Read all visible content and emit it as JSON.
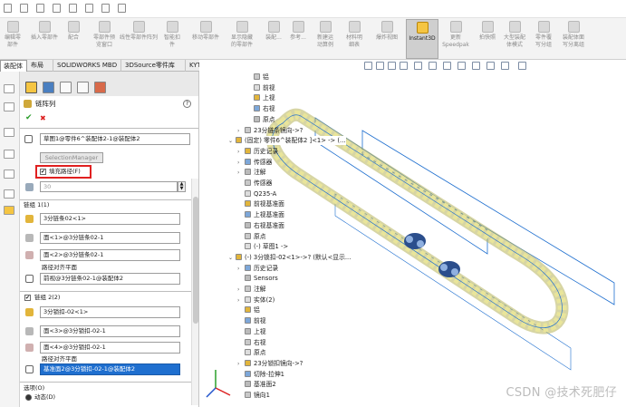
{
  "ribbon": {
    "commands": [
      {
        "label": "编辑零\n部件"
      },
      {
        "label": "插入零部件"
      },
      {
        "label": "配合"
      },
      {
        "label": "零部件预\n览窗口"
      },
      {
        "label": "线性零部件阵列"
      },
      {
        "label": "智能扣\n件"
      },
      {
        "label": "移动零部件"
      },
      {
        "label": "显示隐藏\n的零部件"
      },
      {
        "label": "装配..."
      },
      {
        "label": "参考..."
      },
      {
        "label": "新建运\n动算例"
      },
      {
        "label": "材料明\n细表"
      },
      {
        "label": "爆炸视图"
      },
      {
        "label": "Instant3D"
      },
      {
        "label": "更新\nSpeedpak"
      },
      {
        "label": "拍快照"
      },
      {
        "label": "大型装配\n体模式"
      },
      {
        "label": "零件覆\n写分组"
      },
      {
        "label": "装配体面\n写分离组"
      }
    ]
  },
  "tabs": [
    "装配体",
    "布局",
    "SOLIDWORKS MBD",
    "3DSource零件库",
    "KYTool"
  ],
  "panel": {
    "title": "链阵列",
    "help": "?",
    "ok": "✔",
    "cancel": "✖",
    "path_field": "草图1@零件6^装配体2-1@装配体2",
    "selection_manager": "SelectionManager",
    "fill_path": "填充路径(F)",
    "fill_checked": "✔",
    "count_value": "30",
    "group1": {
      "title": "链组 1(1)",
      "f1": "3分链条02<1>",
      "f2": "面<1>@3分链条02-1",
      "f3": "面<2>@3分链条02-1",
      "path_plane_label": "路径对齐平面",
      "path_plane": "前视@3分链条02-1@装配体2"
    },
    "group2": {
      "title": "链组 2(2)",
      "checked": "✔",
      "f1": "3分锁扣-02<1>",
      "f2": "面<3>@3分锁扣-02-1",
      "f3": "面<4>@3分锁扣-02-1",
      "path_plane_label": "路径对齐平面",
      "path_plane": "基准面2@3分锁扣-02-1@装配体2"
    },
    "options": {
      "title": "选项(O)",
      "dynamic": "动态(D)"
    }
  },
  "tree": [
    {
      "text": "铝",
      "indent": 2,
      "arrow": ""
    },
    {
      "text": "前视",
      "indent": 2,
      "arrow": ""
    },
    {
      "text": "上视",
      "indent": 2,
      "arrow": ""
    },
    {
      "text": "右视",
      "indent": 2,
      "arrow": ""
    },
    {
      "text": "原点",
      "indent": 2,
      "arrow": ""
    },
    {
      "text": "23分链条镜向->?",
      "indent": 1,
      "arrow": "›"
    },
    {
      "text": "(固定) 零件6^装配体2 ]<1> -> (...",
      "indent": 0,
      "arrow": "⌄"
    },
    {
      "text": "历史记录",
      "indent": 1,
      "arrow": "›"
    },
    {
      "text": "传感器",
      "indent": 1,
      "arrow": "›"
    },
    {
      "text": "注解",
      "indent": 1,
      "arrow": "›"
    },
    {
      "text": "传感器",
      "indent": 1,
      "arrow": ""
    },
    {
      "text": "Q235-A",
      "indent": 1,
      "arrow": ""
    },
    {
      "text": "前视基准面",
      "indent": 1,
      "arrow": ""
    },
    {
      "text": "上视基准面",
      "indent": 1,
      "arrow": ""
    },
    {
      "text": "右视基准面",
      "indent": 1,
      "arrow": ""
    },
    {
      "text": "原点",
      "indent": 1,
      "arrow": ""
    },
    {
      "text": "(-) 草图1 ->",
      "indent": 1,
      "arrow": ""
    },
    {
      "text": "(-) 3分锁扣-02<1>->? (默认<显示...",
      "indent": 0,
      "arrow": "⌄"
    },
    {
      "text": "历史记录",
      "indent": 1,
      "arrow": "›"
    },
    {
      "text": "Sensors",
      "indent": 1,
      "arrow": ""
    },
    {
      "text": "注解",
      "indent": 1,
      "arrow": "›"
    },
    {
      "text": "实体(2)",
      "indent": 1,
      "arrow": "›"
    },
    {
      "text": "铝",
      "indent": 1,
      "arrow": ""
    },
    {
      "text": "前视",
      "indent": 1,
      "arrow": ""
    },
    {
      "text": "上视",
      "indent": 1,
      "arrow": ""
    },
    {
      "text": "右视",
      "indent": 1,
      "arrow": ""
    },
    {
      "text": "原点",
      "indent": 1,
      "arrow": ""
    },
    {
      "text": "23分锁扣镜向->?",
      "indent": 1,
      "arrow": "›"
    },
    {
      "text": "切除-拉伸1",
      "indent": 1,
      "arrow": ""
    },
    {
      "text": "基准面2",
      "indent": 1,
      "arrow": ""
    },
    {
      "text": "镜向1",
      "indent": 1,
      "arrow": ""
    }
  ],
  "colors": {
    "highlight_red": "#e02020",
    "selection_blue": "#1f6fcf",
    "chain_yellow": "#e9e59a",
    "chain_edge": "#b7b35a",
    "lock_blue": "#2b4e8c"
  },
  "watermark": "CSDN @技术死肥仔"
}
